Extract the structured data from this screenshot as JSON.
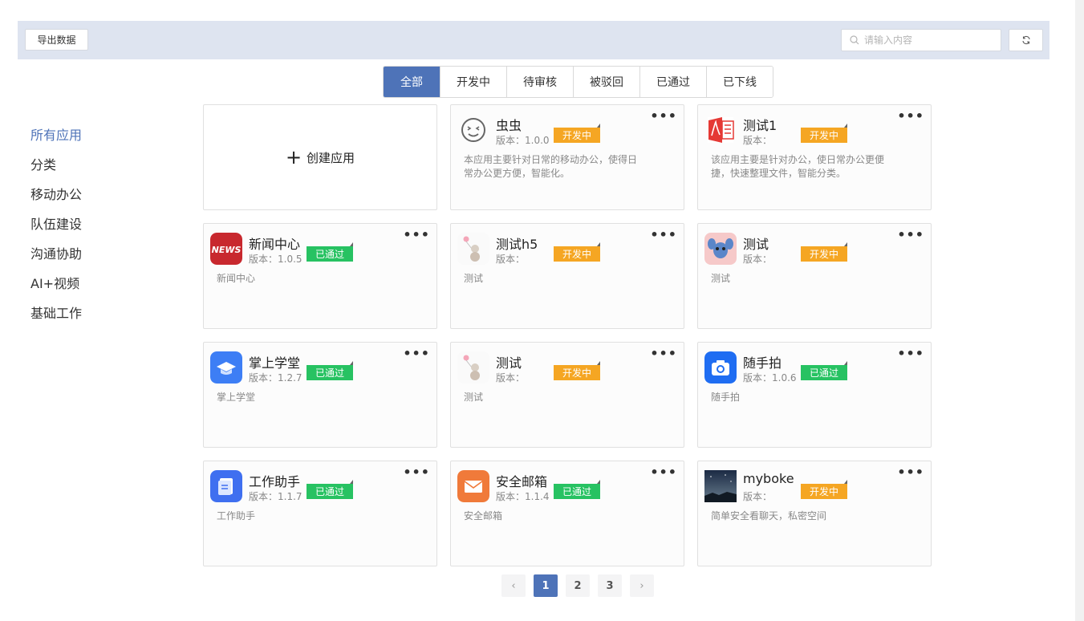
{
  "toolbar": {
    "export_label": "导出数据",
    "search_placeholder": "请输入内容"
  },
  "tabs": [
    "全部",
    "开发中",
    "待审核",
    "被驳回",
    "已通过",
    "已下线"
  ],
  "active_tab": "全部",
  "sidebar": {
    "items": [
      "所有应用",
      "分类",
      "移动办公",
      "队伍建设",
      "沟通协助",
      "AI+视频",
      "基础工作"
    ],
    "active": "所有应用"
  },
  "create_card": {
    "label": "创建应用"
  },
  "version_prefix": "版本：",
  "apps": [
    {
      "name": "虫虫",
      "version": "1.0.0",
      "status": "开发中",
      "icon": "smiley-face-icon",
      "desc": "本应用主要针对日常的移动办公，使得日常办公更方便，智能化。"
    },
    {
      "name": "测试1",
      "version": "",
      "status": "开发中",
      "icon": "pdf-document-icon",
      "desc": "该应用主要是针对办公，使日常办公更便捷，快速整理文件，智能分类。"
    },
    {
      "name": "新闻中心",
      "version": "1.0.5",
      "status": "已通过",
      "icon": "news-icon",
      "desc": "新闻中心"
    },
    {
      "name": "测试h5",
      "version": "",
      "status": "开发中",
      "icon": "teddy-bear-balloon-icon",
      "desc": "测试"
    },
    {
      "name": "测试",
      "version": "",
      "status": "开发中",
      "icon": "cartoon-character-icon",
      "desc": "测试"
    },
    {
      "name": "掌上学堂",
      "version": "1.2.7",
      "status": "已通过",
      "icon": "graduation-cap-icon",
      "desc": "掌上学堂"
    },
    {
      "name": "测试",
      "version": "",
      "status": "开发中",
      "icon": "teddy-bear-balloon-icon",
      "desc": "测试"
    },
    {
      "name": "随手拍",
      "version": "1.0.6",
      "status": "已通过",
      "icon": "camera-icon",
      "desc": "随手拍"
    },
    {
      "name": "工作助手",
      "version": "1.1.7",
      "status": "已通过",
      "icon": "notebook-icon",
      "desc": "工作助手"
    },
    {
      "name": "安全邮箱",
      "version": "1.1.4",
      "status": "已通过",
      "icon": "envelope-icon",
      "desc": "安全邮箱"
    },
    {
      "name": "myboke",
      "version": "",
      "status": "开发中",
      "icon": "night-sky-photo-icon",
      "desc": "简单安全看聊天，私密空间"
    }
  ],
  "pagination": {
    "pages": [
      "1",
      "2",
      "3"
    ],
    "current": "1",
    "prev": "‹",
    "next": "›"
  },
  "colors": {
    "accent": "#4e73b8",
    "dev": "#f5a623",
    "pass": "#27c262",
    "toolbar_bg": "#dee4f0"
  }
}
